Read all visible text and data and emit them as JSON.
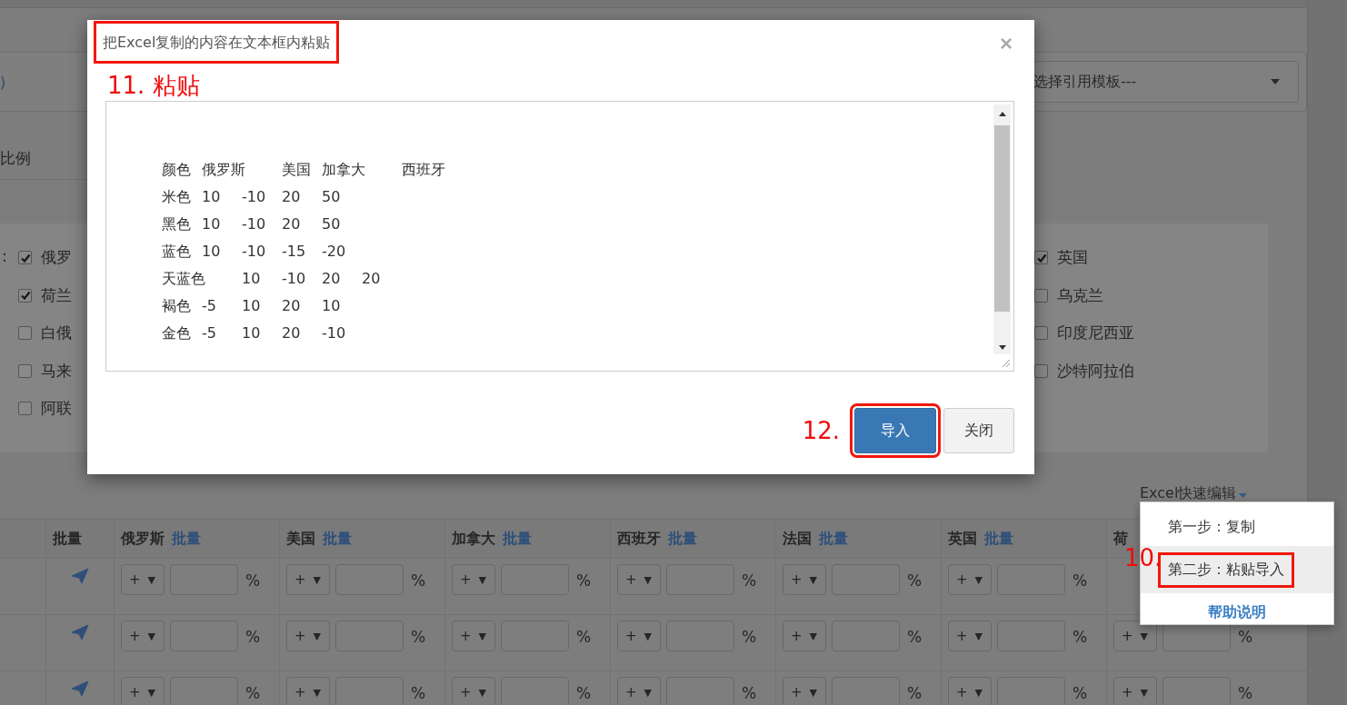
{
  "page": {
    "fragment": ")",
    "ratio_label": "比例",
    "template_select": {
      "value": "选择引用模板---"
    },
    "country_checks": {
      "prefix": ":",
      "left": [
        {
          "label": "俄罗",
          "checked": true
        },
        {
          "label": "荷兰",
          "checked": true
        },
        {
          "label": "白俄",
          "checked": false
        },
        {
          "label": "马来",
          "checked": false
        },
        {
          "label": "阿联",
          "checked": false
        }
      ],
      "right": [
        {
          "label": "英国",
          "checked": true
        },
        {
          "label": "乌克兰",
          "checked": false
        },
        {
          "label": "印度尼西亚",
          "checked": false
        },
        {
          "label": "沙特阿拉伯",
          "checked": false
        }
      ]
    },
    "excel_link": "Excel快速编辑",
    "table": {
      "columns": [
        {
          "label": "批量"
        },
        {
          "label": "俄罗斯",
          "link": "批量"
        },
        {
          "label": "美国",
          "link": "批量"
        },
        {
          "label": "加拿大",
          "link": "批量"
        },
        {
          "label": "西班牙",
          "link": "批量"
        },
        {
          "label": "法国",
          "link": "批量"
        },
        {
          "label": "英国",
          "link": "批量"
        },
        {
          "label": "荷"
        }
      ],
      "rows": [
        {
          "cells": [
            {
              "kind": "send"
            },
            {
              "kind": "input",
              "sign": "+",
              "caret": "▼",
              "unit": "%"
            },
            {
              "kind": "input",
              "sign": "+",
              "caret": "▼",
              "unit": "%"
            },
            {
              "kind": "input",
              "sign": "+",
              "caret": "▼",
              "unit": "%"
            },
            {
              "kind": "input",
              "sign": "+",
              "caret": "▼",
              "unit": "%"
            },
            {
              "kind": "input",
              "sign": "+",
              "caret": "▼",
              "unit": "%"
            },
            {
              "kind": "input",
              "sign": "+",
              "caret": "▼",
              "unit": "%"
            }
          ]
        },
        {
          "cells": [
            {
              "kind": "send"
            },
            {
              "kind": "input",
              "sign": "+",
              "caret": "▼",
              "unit": "%"
            },
            {
              "kind": "input",
              "sign": "+",
              "caret": "▼",
              "unit": "%"
            },
            {
              "kind": "input",
              "sign": "+",
              "caret": "▼",
              "unit": "%"
            },
            {
              "kind": "input",
              "sign": "+",
              "caret": "▼",
              "unit": "%"
            },
            {
              "kind": "input",
              "sign": "+",
              "caret": "▼",
              "unit": "%"
            },
            {
              "kind": "input",
              "sign": "+",
              "caret": "▼",
              "unit": "%"
            },
            {
              "kind": "input",
              "sign": "+",
              "caret": "▼",
              "unit": "%"
            }
          ]
        },
        {
          "cells": [
            {
              "kind": "send"
            },
            {
              "kind": "input",
              "sign": "+",
              "caret": "▼",
              "unit": "%"
            },
            {
              "kind": "input",
              "sign": "+",
              "caret": "▼",
              "unit": "%"
            },
            {
              "kind": "input",
              "sign": "+",
              "caret": "▼",
              "unit": "%"
            },
            {
              "kind": "input",
              "sign": "+",
              "caret": "▼",
              "unit": "%"
            },
            {
              "kind": "input",
              "sign": "+",
              "caret": "▼",
              "unit": "%"
            },
            {
              "kind": "input",
              "sign": "+",
              "caret": "▼",
              "unit": "%"
            },
            {
              "kind": "input",
              "sign": "+",
              "caret": "▼",
              "unit": "%"
            }
          ]
        }
      ]
    }
  },
  "excel_menu": {
    "annotation": "10.",
    "items": [
      {
        "label": "第一步：复制",
        "kind": "step",
        "selected": false,
        "highlighted": false
      },
      {
        "label": "第二步：粘贴导入",
        "kind": "step",
        "selected": true,
        "highlighted": true
      },
      {
        "label": "帮助说明",
        "kind": "help",
        "selected": false,
        "highlighted": false
      }
    ]
  },
  "dialog": {
    "title": "把Excel复制的内容在文本框内粘贴",
    "title_highlighted": true,
    "close": "×",
    "annotation": "11. 粘贴",
    "textarea": {
      "lines": [
        "颜色\t俄罗斯\t美国\t加拿大\t西班牙",
        "米色\t10\t-10\t20\t50",
        "黑色\t10\t-10\t20\t50",
        "蓝色\t10\t-10\t-15\t-20",
        "天蓝色\t10\t-10\t20\t20",
        "褐色\t-5\t10\t20\t10",
        "金色\t-5\t10\t20\t-10"
      ]
    },
    "footer_annotation": "12.",
    "buttons": [
      {
        "label": "导入",
        "kind": "primary",
        "highlighted": true
      },
      {
        "label": "关闭",
        "kind": "default",
        "highlighted": false
      }
    ]
  }
}
